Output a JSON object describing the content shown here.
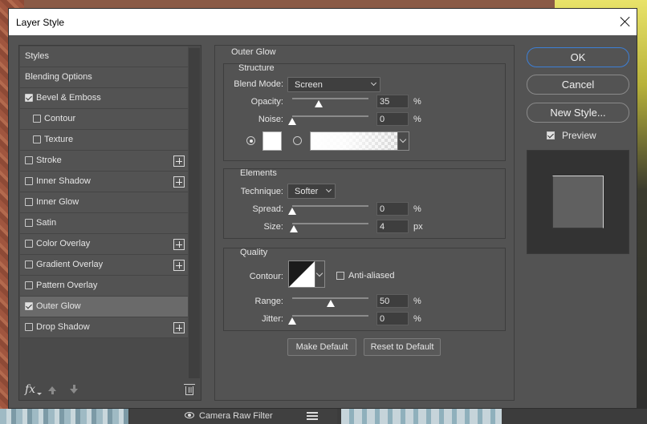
{
  "dialog": {
    "title": "Layer Style"
  },
  "background": {
    "camera_raw_label": "Camera Raw Filter"
  },
  "styles_list": [
    {
      "label": "Styles",
      "checkbox": null,
      "plus": false,
      "indent": false
    },
    {
      "label": "Blending Options",
      "checkbox": null,
      "plus": false,
      "indent": false
    },
    {
      "label": "Bevel & Emboss",
      "checkbox": true,
      "plus": false,
      "indent": false
    },
    {
      "label": "Contour",
      "checkbox": false,
      "plus": false,
      "indent": true
    },
    {
      "label": "Texture",
      "checkbox": false,
      "plus": false,
      "indent": true
    },
    {
      "label": "Stroke",
      "checkbox": false,
      "plus": true,
      "indent": false
    },
    {
      "label": "Inner Shadow",
      "checkbox": false,
      "plus": true,
      "indent": false
    },
    {
      "label": "Inner Glow",
      "checkbox": false,
      "plus": false,
      "indent": false
    },
    {
      "label": "Satin",
      "checkbox": false,
      "plus": false,
      "indent": false
    },
    {
      "label": "Color Overlay",
      "checkbox": false,
      "plus": true,
      "indent": false
    },
    {
      "label": "Gradient Overlay",
      "checkbox": false,
      "plus": true,
      "indent": false
    },
    {
      "label": "Pattern Overlay",
      "checkbox": false,
      "plus": false,
      "indent": false
    },
    {
      "label": "Outer Glow",
      "checkbox": true,
      "plus": false,
      "indent": false,
      "active": true
    },
    {
      "label": "Drop Shadow",
      "checkbox": false,
      "plus": true,
      "indent": false
    }
  ],
  "footer": {
    "fx_label": "fx"
  },
  "outer_glow": {
    "title": "Outer Glow",
    "structure": {
      "title": "Structure",
      "blend_mode_label": "Blend Mode:",
      "blend_mode_value": "Screen",
      "opacity_label": "Opacity:",
      "opacity_value": "35",
      "opacity_fraction": 0.35,
      "opacity_unit": "%",
      "noise_label": "Noise:",
      "noise_value": "0",
      "noise_fraction": 0,
      "noise_unit": "%",
      "color_mode": "solid",
      "glow_color": "#ffffff"
    },
    "elements": {
      "title": "Elements",
      "technique_label": "Technique:",
      "technique_value": "Softer",
      "spread_label": "Spread:",
      "spread_value": "0",
      "spread_fraction": 0,
      "spread_unit": "%",
      "size_label": "Size:",
      "size_value": "4",
      "size_fraction": 0.02,
      "size_unit": "px"
    },
    "quality": {
      "title": "Quality",
      "contour_label": "Contour:",
      "anti_aliased_label": "Anti-aliased",
      "anti_aliased": false,
      "range_label": "Range:",
      "range_value": "50",
      "range_fraction": 0.5,
      "range_unit": "%",
      "jitter_label": "Jitter:",
      "jitter_value": "0",
      "jitter_fraction": 0,
      "jitter_unit": "%"
    },
    "make_default_label": "Make Default",
    "reset_default_label": "Reset to Default"
  },
  "actions": {
    "ok_label": "OK",
    "cancel_label": "Cancel",
    "new_style_label": "New Style...",
    "preview_label": "Preview",
    "preview_checked": true
  },
  "colors": {
    "accent": "#3c7fd6",
    "panel": "#535353"
  }
}
